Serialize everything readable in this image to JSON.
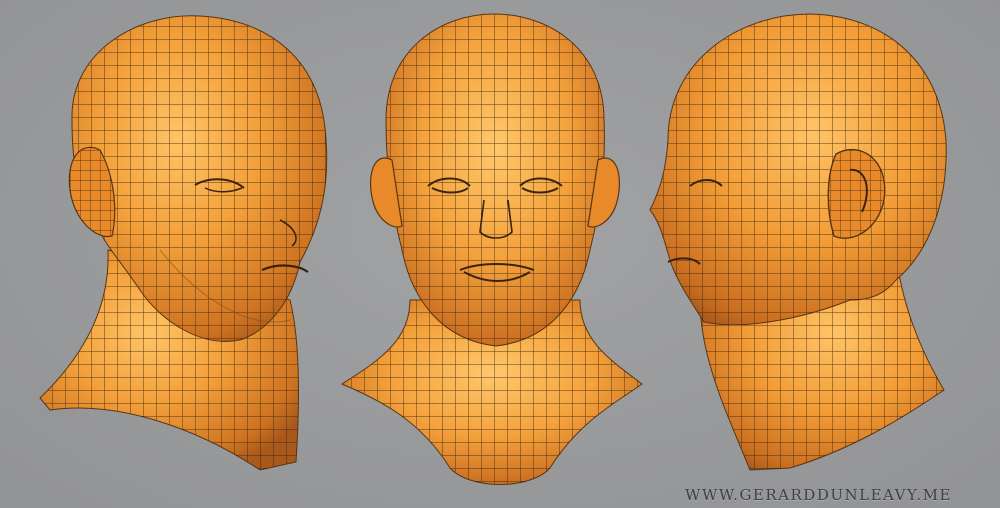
{
  "watermark": {
    "text": "WWW.GERARDDUNLEAVY.ME"
  },
  "views": [
    {
      "name": "three-quarter-view"
    },
    {
      "name": "front-view"
    },
    {
      "name": "side-profile-view"
    }
  ],
  "colors": {
    "background": "#999a9c",
    "mesh_light": "#ffbe5a",
    "mesh_mid": "#f0962e",
    "mesh_dark": "#b9621a",
    "wireframe": "#3a2410"
  }
}
